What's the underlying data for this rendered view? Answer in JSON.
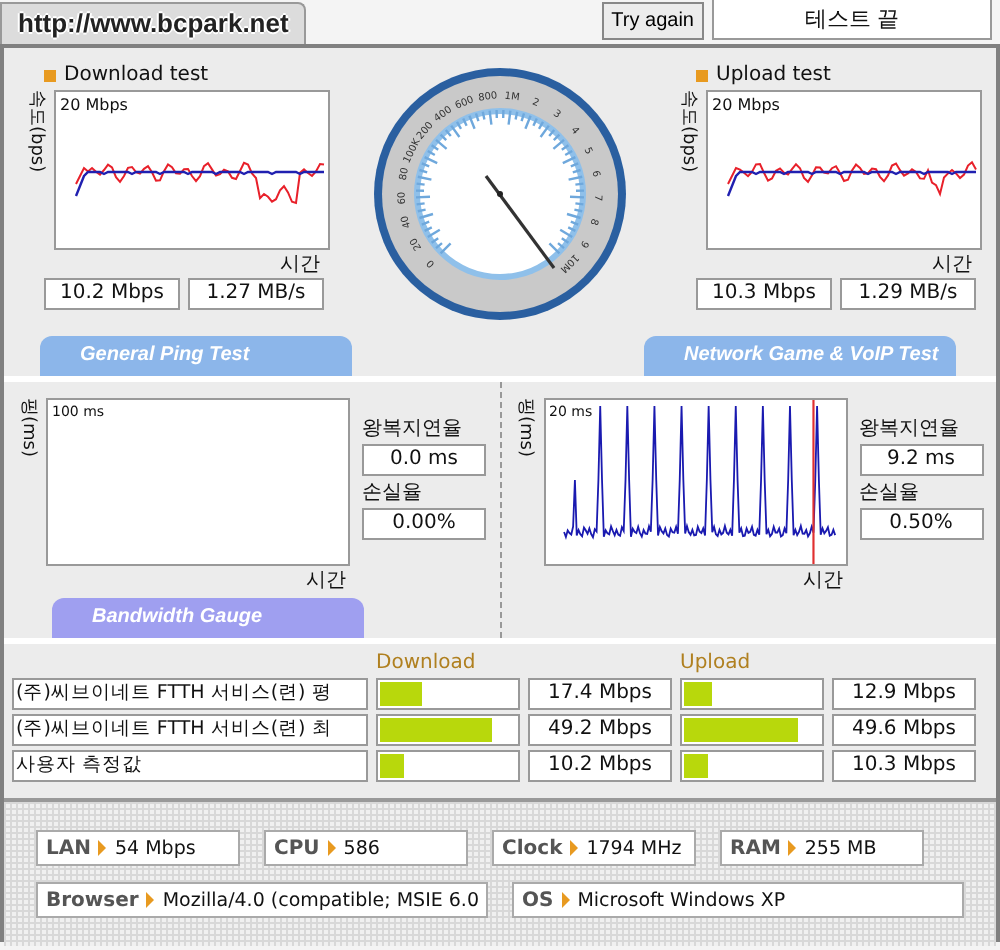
{
  "header": {
    "site_tab": "http://www.bcpark.net",
    "retry_button": "Try again",
    "status": "테스트 끝"
  },
  "gauge": {
    "scale_labels": [
      "0",
      "20",
      "40",
      "60",
      "80",
      "100K",
      "200",
      "400",
      "600",
      "800",
      "1M",
      "2",
      "3",
      "4",
      "5",
      "6",
      "7",
      "8",
      "9",
      "10M"
    ]
  },
  "speed_tests": [
    {
      "title": "Download test",
      "y_axis": "속도(bps)",
      "y_max": "20 Mbps",
      "x_axis": "시간",
      "speed": "10.2 Mbps",
      "rate": "1.27 MB/s"
    },
    {
      "title": "Upload test",
      "y_axis": "속도(bps)",
      "y_max": "20 Mbps",
      "x_axis": "시간",
      "speed": "10.3 Mbps",
      "rate": "1.29 MB/s"
    }
  ],
  "section_tabs": [
    {
      "label": "General Ping Test"
    },
    {
      "label": "Network Game & VoIP Test"
    }
  ],
  "ping_tests": [
    {
      "kind": "empty",
      "y_axis": "핑(ms)",
      "y_max": "100 ms",
      "x_axis": "시간",
      "latency_label": "왕복지연율",
      "latency": "0.0 ms",
      "loss_label": "손실율",
      "loss": "0.00%"
    },
    {
      "kind": "spikes",
      "y_axis": "핑(ms)",
      "y_max": "20 ms",
      "x_axis": "시간",
      "latency_label": "왕복지연율",
      "latency": "9.2 ms",
      "loss_label": "손실율",
      "loss": "0.50%"
    }
  ],
  "bandwidth_tab": "Bandwidth Gauge",
  "comparison": {
    "columns": [
      "Download",
      "Upload"
    ],
    "rows": [
      {
        "name": "(주)씨브이네트 FTTH 서비스(련) 평",
        "download": {
          "level": 0.3,
          "reading": "17.4 Mbps"
        },
        "upload": {
          "level": 0.2,
          "reading": "12.9 Mbps"
        }
      },
      {
        "name": "(주)씨브이네트 FTTH 서비스(련) 최",
        "download": {
          "level": 0.8,
          "reading": "49.2 Mbps"
        },
        "upload": {
          "level": 0.82,
          "reading": "49.6 Mbps"
        }
      },
      {
        "name": "사용자 측정값",
        "download": {
          "level": 0.17,
          "reading": "10.2 Mbps"
        },
        "upload": {
          "level": 0.17,
          "reading": "10.3 Mbps"
        }
      }
    ]
  },
  "system_info": [
    {
      "label": "LAN",
      "value": "54 Mbps"
    },
    {
      "label": "CPU",
      "value": "586"
    },
    {
      "label": "Clock",
      "value": "1794 MHz"
    },
    {
      "label": "RAM",
      "value": "255 MB"
    },
    {
      "label": "Browser",
      "value": "Mozilla/4.0 (compatible; MSIE 6.0"
    },
    {
      "label": "OS",
      "value": "Microsoft Windows XP"
    }
  ]
}
